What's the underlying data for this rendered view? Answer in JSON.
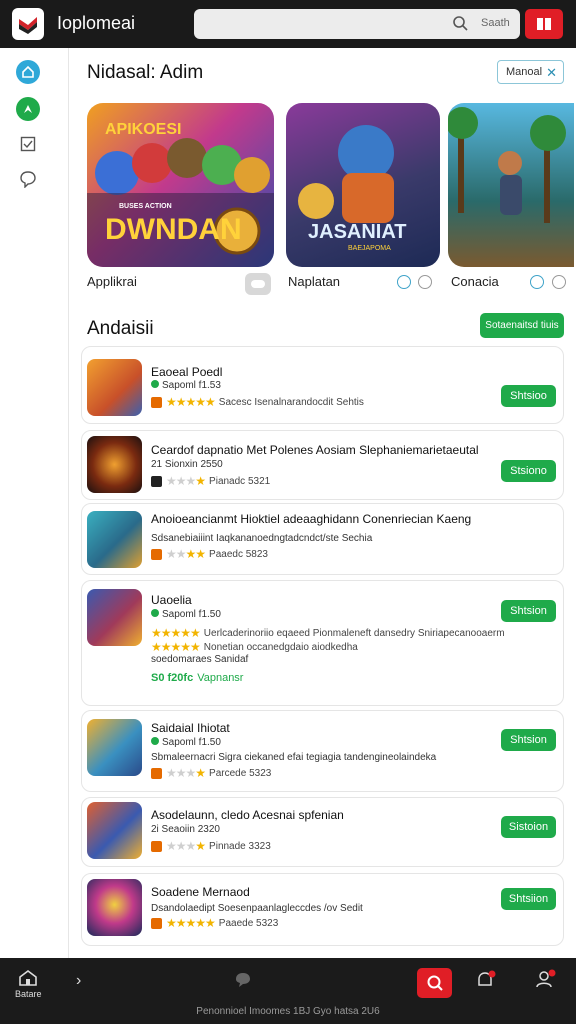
{
  "header": {
    "app_title": "Ioplomeai",
    "search_placeholder": "Saath"
  },
  "featured": {
    "title": "Nidasal: Adim",
    "manage_label": "Manoal",
    "cards": [
      {
        "label": "Applikrai",
        "art_title": "DWNDAN",
        "art_top": "APIKOESI",
        "art_sub": "BUSES ACTION"
      },
      {
        "label": "Naplatan",
        "art_title": "JASANIAT",
        "art_sub": "BAEJAPOMA"
      },
      {
        "label": "Conacia"
      }
    ]
  },
  "list_section": {
    "title": "Andaisii",
    "see_all_label": "Sotaenaitsd tiuis",
    "rows": [
      {
        "title": "Eaoeal Poedl",
        "sub": "Sapoml  f1.53",
        "meta": "Sacesc  Isenalnarandocdit Sehtis",
        "stars_on": 5,
        "button": "Shtsioo"
      },
      {
        "title": "Ceardof dapnatio Met Polenes Aosiam Slephaniemarietaeutal",
        "sub": "21  Sionxin  2550",
        "meta": "Pianadc  5321",
        "stars_on": 3,
        "button": "Stsiono"
      },
      {
        "title": "Anoioeancianmt Hioktiel adeaaghidann Conenriecian Kaeng",
        "sub": "Sdsanebiaiiint  Iaqkananoedngtadcndct/ste Sechia",
        "meta": "Paaedc  5823",
        "stars_on": 3
      },
      {
        "title": "Uaoelia",
        "sub": "Sapoml  f1.50",
        "meta_line1": "Uerlcaderinoriio eqaeed Pionmaleneft dansedry Sniriapecanooaerm",
        "meta_line2": "Nonetian  occanedgdaio aiodkedha",
        "meta_line3": "soedomaraes Sanidaf",
        "price": "S0  f20fc",
        "price_note": "Vapnansr",
        "button": "Shtsion"
      },
      {
        "title": "Saidaial Ihiotat",
        "sub": "Sapoml  f1.50",
        "meta_line1": "Sbmaleernacri Sigra ciekaned efai tegiagia tandengineolaindeka",
        "meta": "Parcede  5323",
        "stars_on": 3,
        "button": "Shtsion"
      },
      {
        "title": "Asodelaunn, cledo Acesnai spfenian",
        "sub": "2i  Seaoiin  2320",
        "meta": "Pinnade  3323",
        "stars_on": 3,
        "button": "Sistoion"
      },
      {
        "title": "Soadene Mernaod",
        "sub": "Dsandolaedipt  Soesenpaanlagleccdes /ov Sedit",
        "meta": "Paaede  5323",
        "stars_on": 5,
        "button": "Shtsiion"
      }
    ]
  },
  "bottom_nav": {
    "home_label": "Batare",
    "footer": "Penonnioel Imoomes 1BJ Gyo hatsa 2U6"
  }
}
